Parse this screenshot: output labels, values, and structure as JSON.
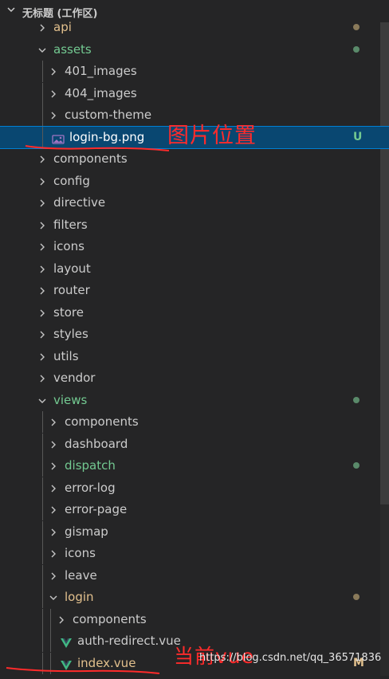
{
  "explorer": {
    "title": "无标题 (工作区)"
  },
  "tree": [
    {
      "label": "api",
      "type": "folder",
      "expanded": false,
      "indent": 0,
      "color": "#e2c08d",
      "dot": "#8a7a5a"
    },
    {
      "label": "assets",
      "type": "folder",
      "expanded": true,
      "indent": 0,
      "color": "#73c991",
      "dot": "#5a8a6a"
    },
    {
      "label": "401_images",
      "type": "folder",
      "expanded": false,
      "indent": 1,
      "color": "#cccccc"
    },
    {
      "label": "404_images",
      "type": "folder",
      "expanded": false,
      "indent": 1,
      "color": "#cccccc"
    },
    {
      "label": "custom-theme",
      "type": "folder",
      "expanded": false,
      "indent": 1,
      "color": "#cccccc"
    },
    {
      "label": "login-bg.png",
      "type": "image-file",
      "indent": 1,
      "color": "#ffffff",
      "badge": "U",
      "selected": true
    },
    {
      "label": "components",
      "type": "folder",
      "expanded": false,
      "indent": 0,
      "color": "#cccccc"
    },
    {
      "label": "config",
      "type": "folder",
      "expanded": false,
      "indent": 0,
      "color": "#cccccc"
    },
    {
      "label": "directive",
      "type": "folder",
      "expanded": false,
      "indent": 0,
      "color": "#cccccc"
    },
    {
      "label": "filters",
      "type": "folder",
      "expanded": false,
      "indent": 0,
      "color": "#cccccc"
    },
    {
      "label": "icons",
      "type": "folder",
      "expanded": false,
      "indent": 0,
      "color": "#cccccc"
    },
    {
      "label": "layout",
      "type": "folder",
      "expanded": false,
      "indent": 0,
      "color": "#cccccc"
    },
    {
      "label": "router",
      "type": "folder",
      "expanded": false,
      "indent": 0,
      "color": "#cccccc"
    },
    {
      "label": "store",
      "type": "folder",
      "expanded": false,
      "indent": 0,
      "color": "#cccccc"
    },
    {
      "label": "styles",
      "type": "folder",
      "expanded": false,
      "indent": 0,
      "color": "#cccccc"
    },
    {
      "label": "utils",
      "type": "folder",
      "expanded": false,
      "indent": 0,
      "color": "#cccccc"
    },
    {
      "label": "vendor",
      "type": "folder",
      "expanded": false,
      "indent": 0,
      "color": "#cccccc"
    },
    {
      "label": "views",
      "type": "folder",
      "expanded": true,
      "indent": 0,
      "color": "#73c991",
      "dot": "#5a8a6a"
    },
    {
      "label": "components",
      "type": "folder",
      "expanded": false,
      "indent": 1,
      "color": "#cccccc"
    },
    {
      "label": "dashboard",
      "type": "folder",
      "expanded": false,
      "indent": 1,
      "color": "#cccccc"
    },
    {
      "label": "dispatch",
      "type": "folder",
      "expanded": false,
      "indent": 1,
      "color": "#73c991",
      "dot": "#5a8a6a"
    },
    {
      "label": "error-log",
      "type": "folder",
      "expanded": false,
      "indent": 1,
      "color": "#cccccc"
    },
    {
      "label": "error-page",
      "type": "folder",
      "expanded": false,
      "indent": 1,
      "color": "#cccccc"
    },
    {
      "label": "gismap",
      "type": "folder",
      "expanded": false,
      "indent": 1,
      "color": "#cccccc"
    },
    {
      "label": "icons",
      "type": "folder",
      "expanded": false,
      "indent": 1,
      "color": "#cccccc"
    },
    {
      "label": "leave",
      "type": "folder",
      "expanded": false,
      "indent": 1,
      "color": "#cccccc"
    },
    {
      "label": "login",
      "type": "folder",
      "expanded": true,
      "indent": 1,
      "color": "#e2c08d",
      "dot": "#8a7a5a"
    },
    {
      "label": "components",
      "type": "folder",
      "expanded": false,
      "indent": 2,
      "color": "#cccccc"
    },
    {
      "label": "auth-redirect.vue",
      "type": "vue-file",
      "indent": 2,
      "color": "#cccccc"
    },
    {
      "label": "index.vue",
      "type": "vue-file",
      "indent": 2,
      "color": "#e2c08d",
      "badge": "M"
    }
  ],
  "annotations": {
    "image_location": "图片位置",
    "current_vue": "当前vue"
  },
  "watermark": "https://blog.csdn.net/qq_36571836",
  "colors": {
    "background": "#252526",
    "selection": "#094771",
    "selection_border": "#007fd4",
    "untracked_green": "#73c991",
    "modified_yellow": "#e2c08d",
    "annotation_red": "#ff2b2b",
    "vue_green": "#41b883"
  }
}
